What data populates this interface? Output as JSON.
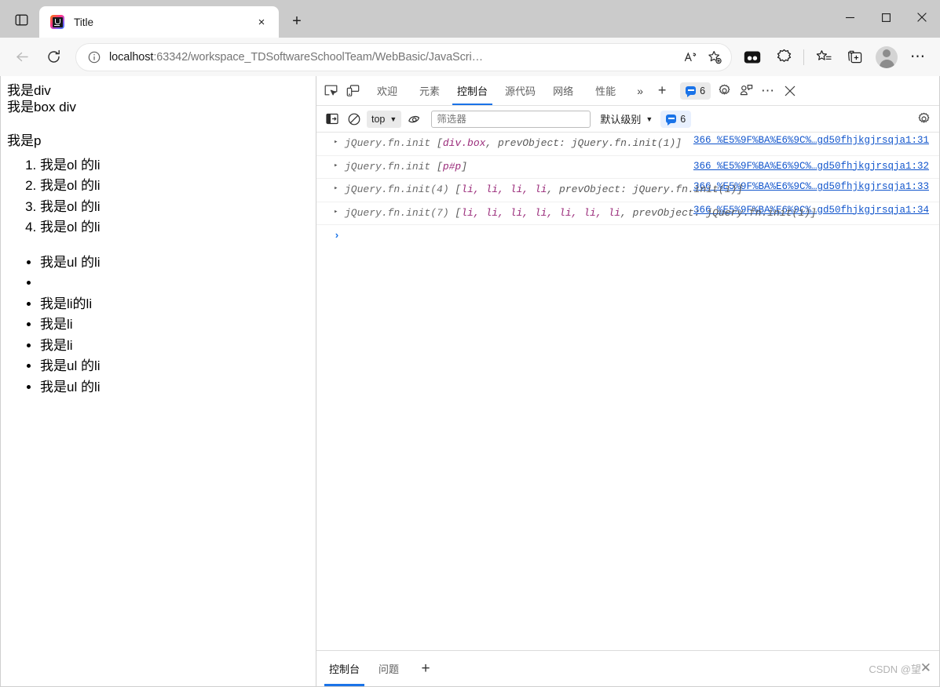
{
  "browser": {
    "tab": {
      "title": "Title",
      "favicon": "jetbrains-icon",
      "close_label": "×"
    },
    "new_tab_label": "+",
    "sidebar_toggle": "sidebar-toggle-icon",
    "window_controls": {
      "minimize": "—",
      "maximize": "□",
      "close": "✕"
    },
    "nav": {
      "back": "back-arrow-icon",
      "reload": "reload-icon",
      "info": "info-icon",
      "url_host": "localhost",
      "url_rest": ":63342/workspace_TDSoftwareSchoolTeam/WebBasic/JavaScri…",
      "read_aloud": "read-aloud-icon",
      "favorite": "add-favorite-icon",
      "split_screen": "split-screen-icon",
      "copilot": "copilot-icon",
      "favorites_list": "favorites-icon",
      "collections": "collections-icon",
      "profile": "profile-avatar-icon",
      "settings_more": "⋯"
    }
  },
  "page": {
    "div_text": "我是div",
    "box_div_text": "我是box div",
    "p_text": "我是p",
    "ol_items": [
      "我是ol 的li",
      "我是ol 的li",
      "我是ol 的li",
      "我是ol 的li"
    ],
    "ul_items": [
      "我是ul 的li",
      "",
      "我是li的li",
      "我是li",
      "我是li",
      "我是ul 的li",
      "我是ul 的li"
    ]
  },
  "devtools": {
    "inspect_icon": "inspect-element-icon",
    "device_icon": "device-toolbar-icon",
    "tabs": [
      {
        "label": "欢迎",
        "active": false
      },
      {
        "label": "元素",
        "active": false
      },
      {
        "label": "控制台",
        "active": true
      },
      {
        "label": "源代码",
        "active": false
      },
      {
        "label": "网络",
        "active": false
      },
      {
        "label": "性能",
        "active": false
      }
    ],
    "more_tabs": "»",
    "add_tab": "+",
    "issue_count": "6",
    "settings_icon": "gear-icon",
    "customize_icon": "devtools-feedback-icon",
    "more_icon": "⋯",
    "close_icon": "✕",
    "filterbar": {
      "sidebar_toggle": "console-sidebar-icon",
      "clear_icon": "clear-console-icon",
      "context": "top",
      "eye_icon": "live-expression-icon",
      "filter_placeholder": "筛选器",
      "filter_value": "",
      "level": "默认级别",
      "issues_count": "6",
      "settings_icon": "console-settings-icon"
    },
    "logs": [
      {
        "arrow": "▸",
        "prefix": "jQuery.fn.init",
        "bracket_open": " [",
        "node": "div.box",
        "tail": ", prevObject: jQuery.fn.init(1)]",
        "source": "366_%E5%9F%BA%E6%9C%…gd50fhjkgjrsqja1:31"
      },
      {
        "arrow": "▸",
        "prefix": "jQuery.fn.init",
        "bracket_open": " [",
        "node": "p#p",
        "tail": "]",
        "source": "366_%E5%9F%BA%E6%9C%…gd50fhjkgjrsqja1:32"
      },
      {
        "arrow": "▸",
        "prefix": "jQuery.fn.init(4)",
        "bracket_open": " [",
        "node": "li, li, li, li",
        "tail": ", prevObject: jQuery.fn.init(1)]",
        "source": "366_%E5%9F%BA%E6%9C%…gd50fhjkgjrsqja1:33"
      },
      {
        "arrow": "▸",
        "prefix": "jQuery.fn.init(7)",
        "bracket_open": " [",
        "node": "li, li, li, li, li, li, li",
        "tail": ", prevObject: jQuery.fn.init(1)]",
        "source": "366_%E5%9F%BA%E6%9C%…gd50fhjkgjrsqja1:34"
      }
    ],
    "prompt": "›",
    "drawer": {
      "tabs": [
        {
          "label": "控制台",
          "active": true
        },
        {
          "label": "问题",
          "active": false
        }
      ],
      "add": "+",
      "watermark": "CSDN @望丶",
      "watermark_x": "✕"
    }
  },
  "colors": {
    "accent": "#1a73e8",
    "link": "#1155cc",
    "node": "#9a2b7a",
    "frame": "#cfcfcf"
  }
}
